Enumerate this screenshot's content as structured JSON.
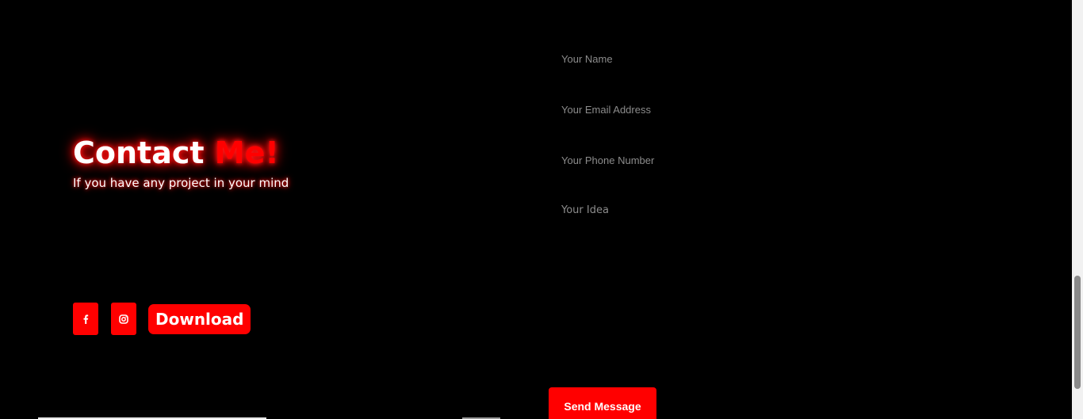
{
  "contact": {
    "title_main": "Contact ",
    "title_accent": "Me!",
    "subtitle": "If you have any project in your mind"
  },
  "socials": [
    {
      "name": "facebook",
      "icon": "facebook-icon"
    },
    {
      "name": "instagram",
      "icon": "instagram-icon"
    }
  ],
  "download": {
    "label": "Download"
  },
  "form": {
    "name_placeholder": "Your Name",
    "email_placeholder": "Your Email Address",
    "phone_placeholder": "Your Phone Number",
    "idea_placeholder": "Your Idea",
    "send_label": "Send Message"
  },
  "colors": {
    "accent": "#ff0000",
    "background": "#000000",
    "text": "#ffffff",
    "placeholder": "#8c8c8c"
  }
}
